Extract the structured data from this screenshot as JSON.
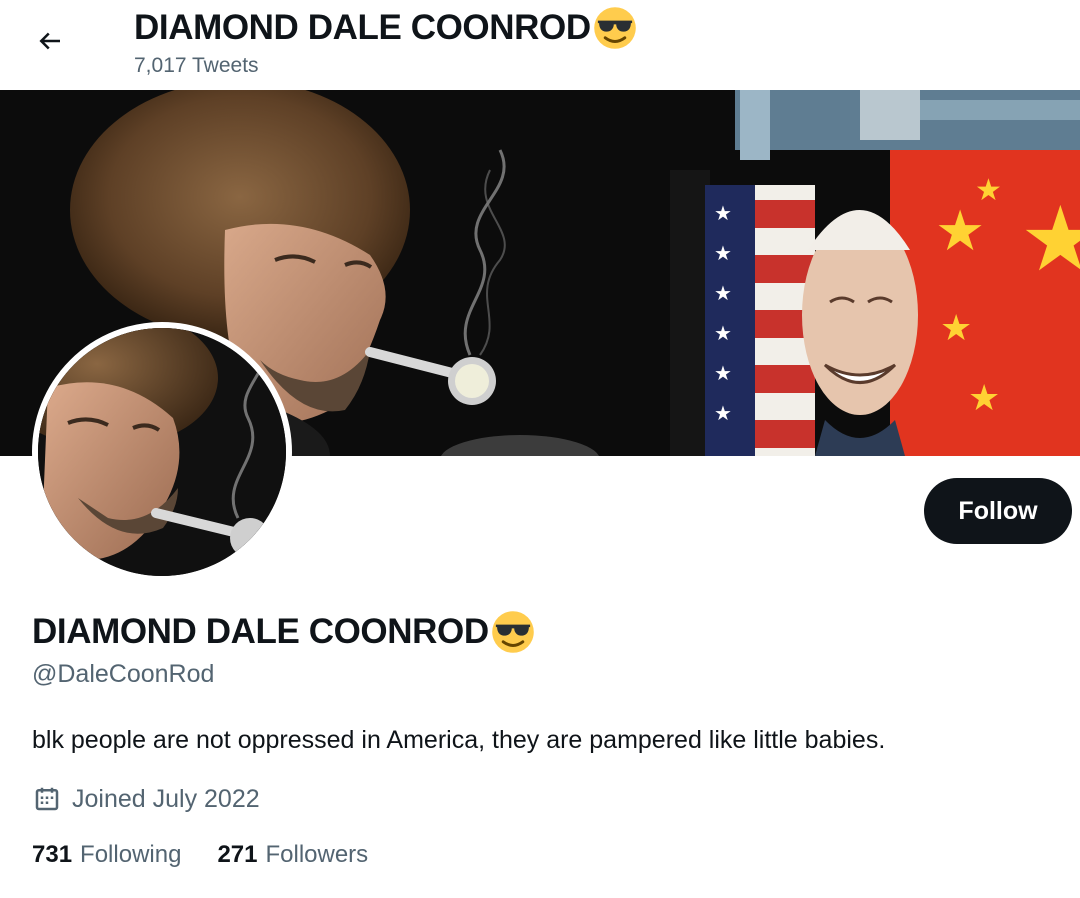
{
  "header": {
    "title": "DIAMOND DALE COONROD",
    "tweet_count": "7,017 Tweets",
    "back_icon": "arrow-left-icon"
  },
  "banner": {
    "description_icon": "banner-image"
  },
  "profile": {
    "display_name": "DIAMOND DALE COONROD",
    "name_emoji": "smiling-face-with-sunglasses-icon",
    "handle": "@DaleCoonRod",
    "bio": "blk people are not oppressed in America, they are pampered like little babies.",
    "joined": "Joined July 2022",
    "joined_icon": "calendar-icon",
    "follow_label": "Follow",
    "following_count": "731",
    "following_label": "Following",
    "followers_count": "271",
    "followers_label": "Followers"
  },
  "colors": {
    "text_primary": "#0f1419",
    "text_secondary": "#536471",
    "follow_button_bg": "#0f1419",
    "follow_button_text": "#ffffff"
  }
}
